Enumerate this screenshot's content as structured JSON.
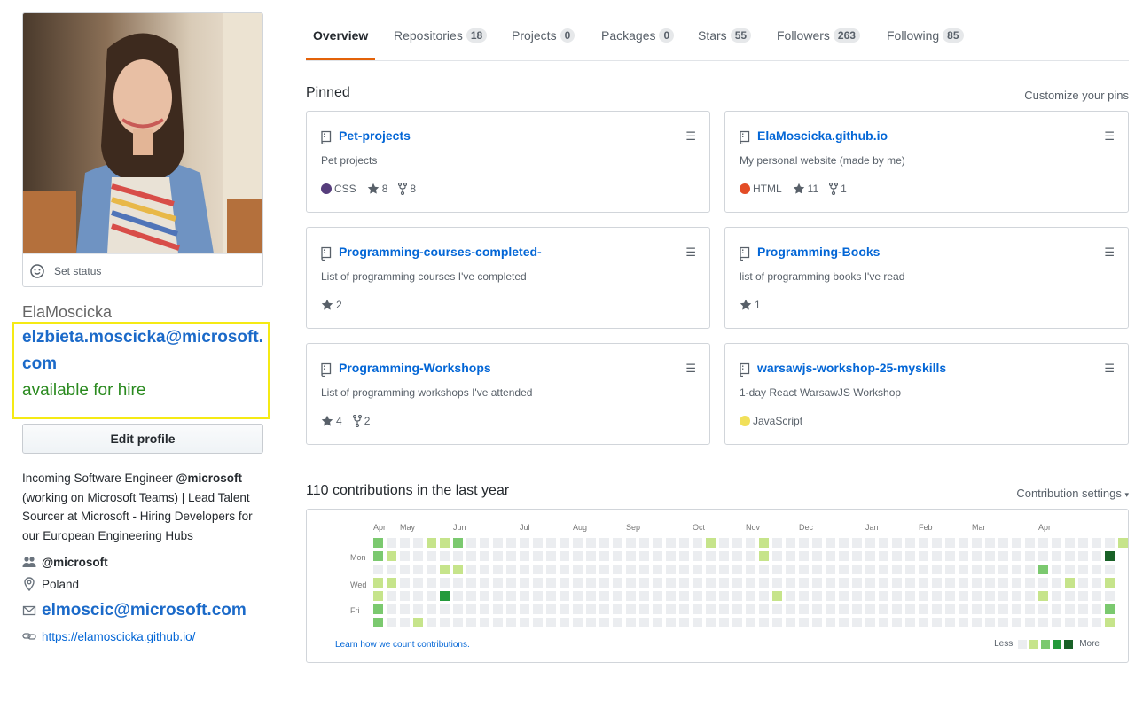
{
  "profile": {
    "status_label": "Set status",
    "username": "ElaMoscicka",
    "email_highlight": "elzbieta.moscicka@microsoft.com",
    "hire_text": "available for hire",
    "edit_profile_label": "Edit profile",
    "bio_part1": "Incoming Software Engineer ",
    "bio_org_mention": "@microsoft",
    "bio_part2": " (working on Microsoft Teams) | Lead Talent Sourcer at Microsoft - Hiring Developers for our European Engineering Hubs",
    "organization": "@microsoft",
    "location": "Poland",
    "email": "elmoscic@microsoft.com",
    "website": "https://elamoscicka.github.io/"
  },
  "tabs": [
    {
      "label": "Overview",
      "count": ""
    },
    {
      "label": "Repositories",
      "count": "18"
    },
    {
      "label": "Projects",
      "count": "0"
    },
    {
      "label": "Packages",
      "count": "0"
    },
    {
      "label": "Stars",
      "count": "55"
    },
    {
      "label": "Followers",
      "count": "263"
    },
    {
      "label": "Following",
      "count": "85"
    }
  ],
  "pinned": {
    "title": "Pinned",
    "customize_label": "Customize your pins",
    "repos": [
      {
        "name": "Pet-projects",
        "description": "Pet projects",
        "language": "CSS",
        "language_color": "#563d7c",
        "stars": "8",
        "forks": "8"
      },
      {
        "name": "ElaMoscicka.github.io",
        "description": "My personal website (made by me)",
        "language": "HTML",
        "language_color": "#e34c26",
        "stars": "11",
        "forks": "1"
      },
      {
        "name": "Programming-courses-completed-",
        "description": "List of programming courses I've completed",
        "language": "",
        "language_color": "",
        "stars": "2",
        "forks": ""
      },
      {
        "name": "Programming-Books",
        "description": "list of programming books I've read",
        "language": "",
        "language_color": "",
        "stars": "1",
        "forks": ""
      },
      {
        "name": "Programming-Workshops",
        "description": "List of programming workshops I've attended",
        "language": "",
        "language_color": "",
        "stars": "4",
        "forks": "2"
      },
      {
        "name": "warsawjs-workshop-25-myskills",
        "description": "1-day React WarsawJS Workshop",
        "language": "JavaScript",
        "language_color": "#f1e05a",
        "stars": "",
        "forks": ""
      }
    ]
  },
  "contributions": {
    "title": "110 contributions in the last year",
    "settings_label": "Contribution settings",
    "learn_label": "Learn how we count contributions.",
    "less_label": "Less",
    "more_label": "More",
    "months": [
      "Apr",
      "May",
      "Jun",
      "Jul",
      "Aug",
      "Sep",
      "Oct",
      "Nov",
      "Dec",
      "Jan",
      "Feb",
      "Mar",
      "Apr"
    ],
    "days": [
      "Mon",
      "Wed",
      "Fri"
    ],
    "colors": [
      "#ebedf0",
      "#c6e48b",
      "#7bc96f",
      "#239a3b",
      "#196127"
    ],
    "weeks": [
      [
        2,
        2,
        0,
        1,
        1,
        2,
        2
      ],
      [
        0,
        1,
        0,
        1,
        0,
        0,
        0
      ],
      [
        0,
        0,
        0,
        0,
        0,
        0,
        0
      ],
      [
        0,
        0,
        0,
        0,
        0,
        0,
        1
      ],
      [
        1,
        0,
        0,
        0,
        0,
        0,
        0
      ],
      [
        1,
        0,
        1,
        0,
        3,
        0,
        0
      ],
      [
        2,
        0,
        1,
        0,
        0,
        0,
        0
      ],
      [
        0,
        0,
        0,
        0,
        0,
        0,
        0
      ],
      [
        0,
        0,
        0,
        0,
        0,
        0,
        0
      ],
      [
        0,
        0,
        0,
        0,
        0,
        0,
        0
      ],
      [
        0,
        0,
        0,
        0,
        0,
        0,
        0
      ],
      [
        0,
        0,
        0,
        0,
        0,
        0,
        0
      ],
      [
        0,
        0,
        0,
        0,
        0,
        0,
        0
      ],
      [
        0,
        0,
        0,
        0,
        0,
        0,
        0
      ],
      [
        0,
        0,
        0,
        0,
        0,
        0,
        0
      ],
      [
        0,
        0,
        0,
        0,
        0,
        0,
        0
      ],
      [
        0,
        0,
        0,
        0,
        0,
        0,
        0
      ],
      [
        0,
        0,
        0,
        0,
        0,
        0,
        0
      ],
      [
        0,
        0,
        0,
        0,
        0,
        0,
        0
      ],
      [
        0,
        0,
        0,
        0,
        0,
        0,
        0
      ],
      [
        0,
        0,
        0,
        0,
        0,
        0,
        0
      ],
      [
        0,
        0,
        0,
        0,
        0,
        0,
        0
      ],
      [
        0,
        0,
        0,
        0,
        0,
        0,
        0
      ],
      [
        0,
        0,
        0,
        0,
        0,
        0,
        0
      ],
      [
        0,
        0,
        0,
        0,
        0,
        0,
        0
      ],
      [
        1,
        0,
        0,
        0,
        0,
        0,
        0
      ],
      [
        0,
        0,
        0,
        0,
        0,
        0,
        0
      ],
      [
        0,
        0,
        0,
        0,
        0,
        0,
        0
      ],
      [
        0,
        0,
        0,
        0,
        0,
        0,
        0
      ],
      [
        1,
        1,
        0,
        0,
        0,
        0,
        0
      ],
      [
        0,
        0,
        0,
        0,
        1,
        0,
        0
      ],
      [
        0,
        0,
        0,
        0,
        0,
        0,
        0
      ],
      [
        0,
        0,
        0,
        0,
        0,
        0,
        0
      ],
      [
        0,
        0,
        0,
        0,
        0,
        0,
        0
      ],
      [
        0,
        0,
        0,
        0,
        0,
        0,
        0
      ],
      [
        0,
        0,
        0,
        0,
        0,
        0,
        0
      ],
      [
        0,
        0,
        0,
        0,
        0,
        0,
        0
      ],
      [
        0,
        0,
        0,
        0,
        0,
        0,
        0
      ],
      [
        0,
        0,
        0,
        0,
        0,
        0,
        0
      ],
      [
        0,
        0,
        0,
        0,
        0,
        0,
        0
      ],
      [
        0,
        0,
        0,
        0,
        0,
        0,
        0
      ],
      [
        0,
        0,
        0,
        0,
        0,
        0,
        0
      ],
      [
        0,
        0,
        0,
        0,
        0,
        0,
        0
      ],
      [
        0,
        0,
        0,
        0,
        0,
        0,
        0
      ],
      [
        0,
        0,
        0,
        0,
        0,
        0,
        0
      ],
      [
        0,
        0,
        0,
        0,
        0,
        0,
        0
      ],
      [
        0,
        0,
        0,
        0,
        0,
        0,
        0
      ],
      [
        0,
        0,
        0,
        0,
        0,
        0,
        0
      ],
      [
        0,
        0,
        0,
        0,
        0,
        0,
        0
      ],
      [
        0,
        0,
        0,
        0,
        0,
        0,
        0
      ],
      [
        0,
        0,
        2,
        0,
        1,
        0,
        0
      ],
      [
        0,
        0,
        0,
        0,
        0,
        0,
        0
      ],
      [
        0,
        0,
        0,
        1,
        0,
        0,
        0
      ],
      [
        0,
        0,
        0,
        0,
        0,
        0,
        0
      ],
      [
        0,
        0,
        0,
        0,
        0,
        0,
        0
      ],
      [
        0,
        4,
        0,
        1,
        0,
        2,
        1
      ]
    ],
    "last_week_days": 7,
    "extra_top_right": 1
  }
}
